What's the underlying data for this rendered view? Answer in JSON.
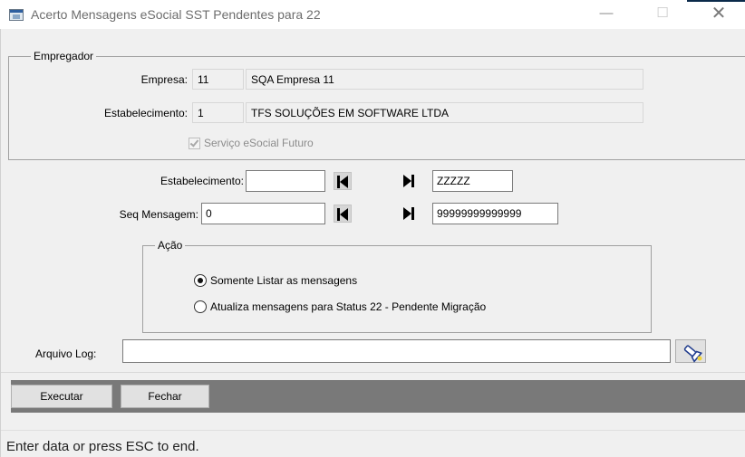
{
  "window": {
    "title": "Acerto Mensagens eSocial SST Pendentes para 22",
    "minimize_glyph": "—",
    "maximize_glyph": "☐",
    "close_glyph": "✕"
  },
  "empregador": {
    "legend": "Empregador",
    "empresa_label": "Empresa:",
    "empresa_code": "11",
    "empresa_name": "SQA Empresa 11",
    "estabelecimento_label": "Estabelecimento:",
    "estabelecimento_code": "1",
    "estabelecimento_name": "TFS SOLUÇÕES EM SOFTWARE LTDA",
    "servico_label": "Serviço eSocial Futuro",
    "servico_checked": true
  },
  "filters": {
    "estabelecimento_label": "Estabelecimento:",
    "estabelecimento_from": "",
    "estabelecimento_to": "ZZZZZ",
    "seq_label": "Seq Mensagem:",
    "seq_from": "0",
    "seq_to": "99999999999999"
  },
  "acao": {
    "legend": "Ação",
    "options": [
      {
        "label": "Somente Listar as mensagens",
        "selected": true
      },
      {
        "label": "Atualiza mensagens para Status 22 - Pendente Migração",
        "selected": false
      }
    ]
  },
  "log": {
    "label": "Arquivo Log:",
    "value": ""
  },
  "buttons": {
    "executar": "Executar",
    "fechar": "Fechar"
  },
  "status": {
    "text": "Enter data or press ESC to end."
  },
  "icons": {
    "app": "window-app-icon",
    "first": "first-record-icon",
    "last": "last-record-icon",
    "browse": "flashlight-icon"
  },
  "colors": {
    "toolbar": "#797979",
    "client_bg": "#f0f0f0",
    "browse_icon": "#1f3b8c"
  }
}
